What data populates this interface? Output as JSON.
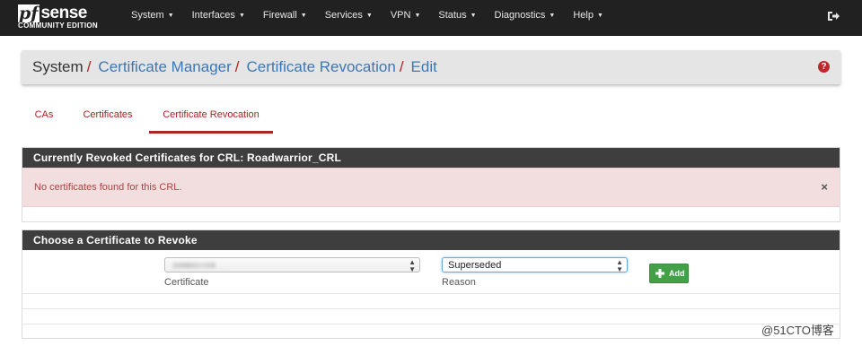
{
  "brand": {
    "pf": "pf",
    "sense": "sense",
    "edition": "COMMUNITY EDITION"
  },
  "nav": {
    "items": [
      {
        "label": "System"
      },
      {
        "label": "Interfaces"
      },
      {
        "label": "Firewall"
      },
      {
        "label": "Services"
      },
      {
        "label": "VPN"
      },
      {
        "label": "Status"
      },
      {
        "label": "Diagnostics"
      },
      {
        "label": "Help"
      }
    ],
    "logout_icon": "logout-icon"
  },
  "breadcrumb": {
    "root": "System",
    "links": [
      "Certificate Manager",
      "Certificate Revocation",
      "Edit"
    ],
    "separator": "/",
    "help_glyph": "?"
  },
  "tabs": [
    {
      "label": "CAs",
      "active": false
    },
    {
      "label": "Certificates",
      "active": false
    },
    {
      "label": "Certificate Revocation",
      "active": true
    }
  ],
  "revoked_panel": {
    "heading": "Currently Revoked Certificates for CRL: Roadwarrior_CRL",
    "alert_text": "No certificates found for this CRL.",
    "alert_close": "×"
  },
  "revoke_panel": {
    "heading": "Choose a Certificate to Revoke",
    "certificate_label": "Certificate",
    "reason_label": "Reason",
    "reason_value": "Superseded",
    "add_label": "Add"
  },
  "watermark": "@51CTO博客",
  "colors": {
    "navbar": "#212121",
    "accent_red": "#b22222",
    "link_blue": "#3a78b8",
    "panel_heading": "#3e3e3e",
    "alert_bg": "#f2dede",
    "add_green": "#43a047"
  }
}
